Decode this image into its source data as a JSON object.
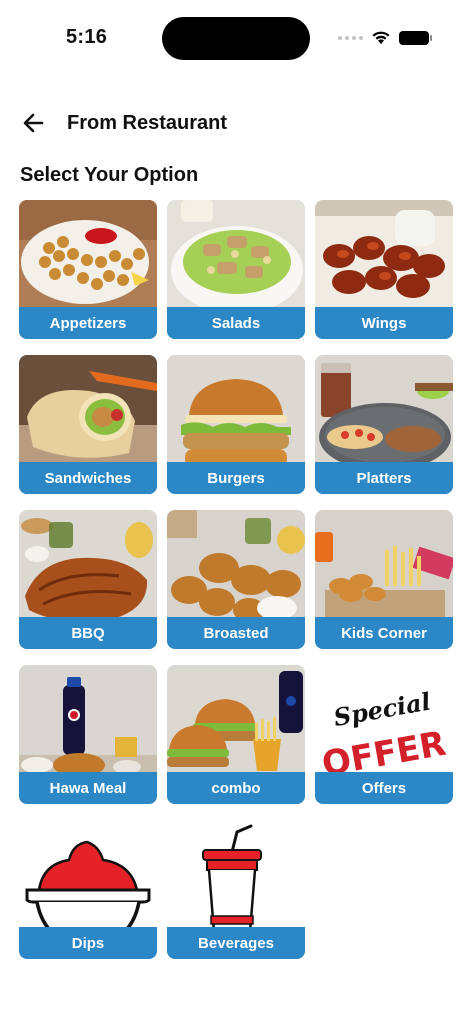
{
  "status_bar": {
    "time": "5:16"
  },
  "header": {
    "title": "From Restaurant",
    "back_icon": "arrow-left-icon"
  },
  "section_title": "Select Your Option",
  "brand": {
    "tile_label_bg": "#2b87c6",
    "offer_red": "#d4202a"
  },
  "offer_art": {
    "line1": "Special",
    "line2": "OFFER"
  },
  "categories": [
    {
      "label": "Appetizers",
      "image": "fried-balls-platter"
    },
    {
      "label": "Salads",
      "image": "caesar-salad"
    },
    {
      "label": "Wings",
      "image": "chicken-wings"
    },
    {
      "label": "Sandwiches",
      "image": "wrap-sandwich"
    },
    {
      "label": "Burgers",
      "image": "chicken-burger"
    },
    {
      "label": "Platters",
      "image": "platter-with-drink"
    },
    {
      "label": "BBQ",
      "image": "grilled-chicken"
    },
    {
      "label": "Broasted",
      "image": "fried-chicken"
    },
    {
      "label": "Kids Corner",
      "image": "kids-meal"
    },
    {
      "label": "Hawa Meal",
      "image": "meal-with-soda"
    },
    {
      "label": "combo",
      "image": "burger-combo"
    },
    {
      "label": "Offers",
      "image": "special-offer-text"
    },
    {
      "label": "Dips",
      "image": "dip-bowl-icon"
    },
    {
      "label": "Beverages",
      "image": "drink-cup-icon"
    }
  ]
}
